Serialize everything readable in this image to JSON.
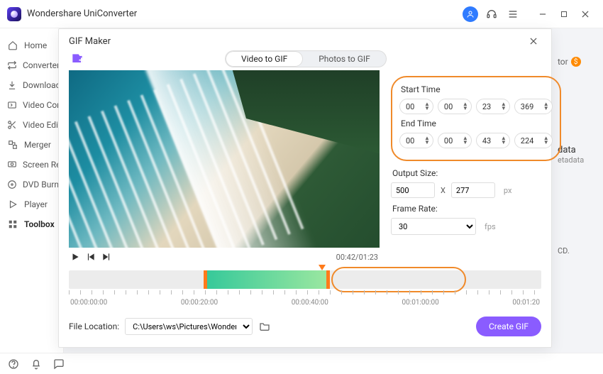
{
  "app": {
    "title": "Wondershare UniConverter"
  },
  "sidebar": {
    "items": [
      {
        "label": "Home"
      },
      {
        "label": "Converter"
      },
      {
        "label": "Downloader"
      },
      {
        "label": "Video Compressor"
      },
      {
        "label": "Video Editor"
      },
      {
        "label": "Merger"
      },
      {
        "label": "Screen Recorder"
      },
      {
        "label": "DVD Burner"
      },
      {
        "label": "Player"
      },
      {
        "label": "Toolbox"
      }
    ]
  },
  "bg": {
    "tor": "tor",
    "data": "data",
    "etadata": "etadata",
    "cd": "CD."
  },
  "modal": {
    "title": "GIF Maker",
    "tabs": {
      "video": "Video to GIF",
      "photos": "Photos to GIF"
    },
    "time_label_start": "Start Time",
    "time_label_end": "End Time",
    "start": {
      "h": "00",
      "m": "00",
      "s": "23",
      "ms": "369"
    },
    "end": {
      "h": "00",
      "m": "00",
      "s": "43",
      "ms": "224"
    },
    "output_label": "Output Size:",
    "output": {
      "w": "500",
      "h": "277",
      "x": "X",
      "unit": "px"
    },
    "frame_label": "Frame Rate:",
    "frame_rate": "30",
    "fps_unit": "fps",
    "playback": {
      "current": "00:42",
      "total": "01:23"
    },
    "ruler": [
      "00:00:00:00",
      "00:00:20:00",
      "00:00:40:00",
      "00:01:00:00",
      "00:01:20"
    ],
    "file_label": "File Location:",
    "file_path": "C:\\Users\\ws\\Pictures\\Wonders",
    "create": "Create GIF"
  }
}
